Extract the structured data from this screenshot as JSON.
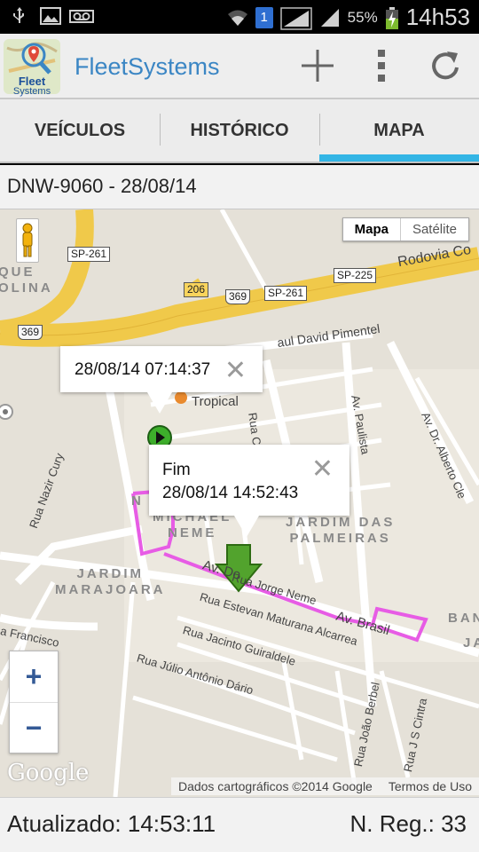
{
  "statusbar": {
    "battery_pct": "55%",
    "time": "14h53",
    "notification_count": "1",
    "icons": [
      "usb-icon",
      "image-icon",
      "voicemail-icon",
      "wifi-icon",
      "sim-badge-icon",
      "signal-icon",
      "signal-icon",
      "battery-charging-icon"
    ]
  },
  "appbar": {
    "title": "FleetSystems",
    "logo_text_line1": "Fleet",
    "logo_text_line2": "Systems",
    "accent": "#3b86c4"
  },
  "tabs": [
    {
      "label": "VEÍCULOS",
      "active": false
    },
    {
      "label": "HISTÓRICO",
      "active": false
    },
    {
      "label": "MAPA",
      "active": true
    }
  ],
  "vehicle": {
    "title": "DNW-9060 - 28/08/14"
  },
  "map": {
    "maptype": {
      "map": "Mapa",
      "satellite": "Satélite",
      "selected": "Mapa"
    },
    "labels": {
      "rodovia": "Rodovia Co",
      "sp261_a": "SP-261",
      "sp261_b": "SP-261",
      "sp225": "SP-225",
      "r206": "206",
      "r369_a": "369",
      "r369_b": "369",
      "paul_david": "aul David Pimentel",
      "tropical": "Tropical",
      "rua_c_ma": "Rua C Ma",
      "av_paulista": "Av. Paulista",
      "av_dr_alberto": "Av. Dr. Alberto Cle",
      "jardim_palmeiras": "JARDIM DAS\nPALMEIRAS",
      "michael_neme": "MICHAEL\nNEME",
      "jardim_marajoara": "JARDIM\nMARAJOARA",
      "que_olina": "QUE\nOLINA",
      "nu_top": "N",
      "rua_jorge_neme": "Rua Jorge Neme",
      "rua_estevan": "Rua Estevan Maturana Alcarrea",
      "rua_jacinto": "Rua Jacinto Guiraldele",
      "rua_julio": "Rua Júlio Antônio Dário",
      "av_brasil": "Av. Brasil",
      "rua_nazir": "Rua Nazir Cury",
      "francisco": "a Francisco",
      "rua_joao_berbel": "Rua João Berbel",
      "rua_j_s_cintra": "Rua J S Cintra",
      "ban": "BAN",
      "ja": "JA",
      "av_do": "Av. Do"
    },
    "start_popup": {
      "text": "28/08/14 07:14:37"
    },
    "end_popup": {
      "title": "Fim",
      "text": "28/08/14 14:52:43"
    },
    "zoom_in": "+",
    "zoom_out": "−",
    "google_logo": "Google",
    "attribution": "Dados cartográficos ©2014 Google",
    "terms": "Termos de Uso",
    "route_color": "#e75ce5",
    "start_marker_color": "#3dae2b",
    "end_marker_color": "#4fa62c"
  },
  "footer": {
    "updated": "Atualizado: 14:53:11",
    "records": "N. Reg.: 33"
  }
}
